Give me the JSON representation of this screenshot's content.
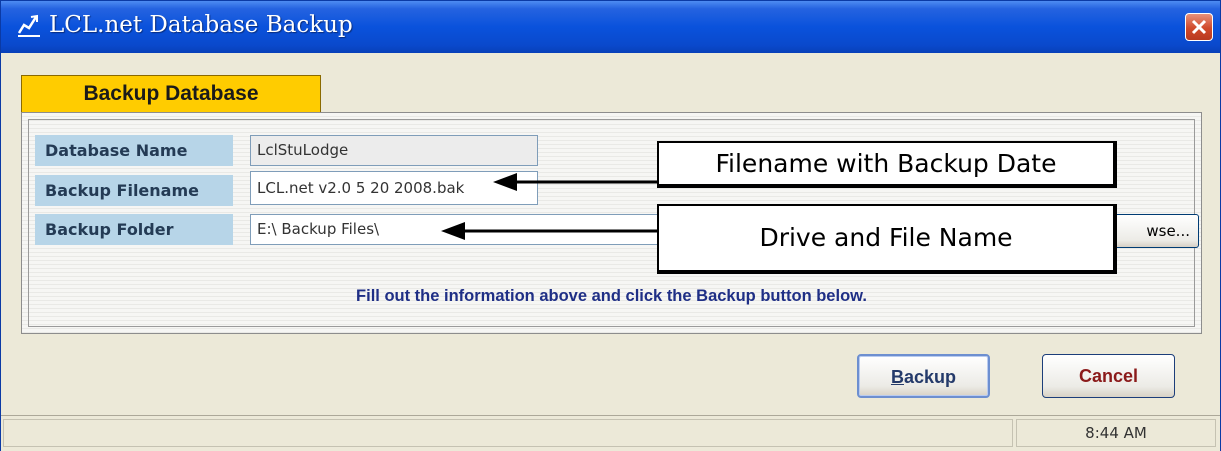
{
  "window": {
    "title": "LCL.net Database Backup",
    "icon": "chart-icon",
    "close_icon": "close-icon"
  },
  "tab": {
    "label": "Backup Database"
  },
  "form": {
    "fields": [
      {
        "label": "Database Name",
        "value": "LclStuLodge"
      },
      {
        "label": "Backup Filename",
        "value": "LCL.net v2.0 5 20 2008.bak"
      },
      {
        "label": "Backup Folder",
        "value": "E:\\ Backup Files\\"
      }
    ],
    "browse_label": "wse...",
    "instruction": "Fill out the information above and click the Backup button below."
  },
  "annotations": {
    "filename_callout": "Filename with Backup Date",
    "folder_callout": "Drive and File Name"
  },
  "buttons": {
    "backup_prefix": "B",
    "backup_rest": "ackup",
    "cancel": "Cancel"
  },
  "statusbar": {
    "time": "8:44 AM"
  },
  "colors": {
    "tab": "#ffcc00",
    "label_bg": "#b7d5e8",
    "cancel_text": "#8b1a1a",
    "backup_text": "#243a6a",
    "title_bar": "#0a52dc"
  }
}
